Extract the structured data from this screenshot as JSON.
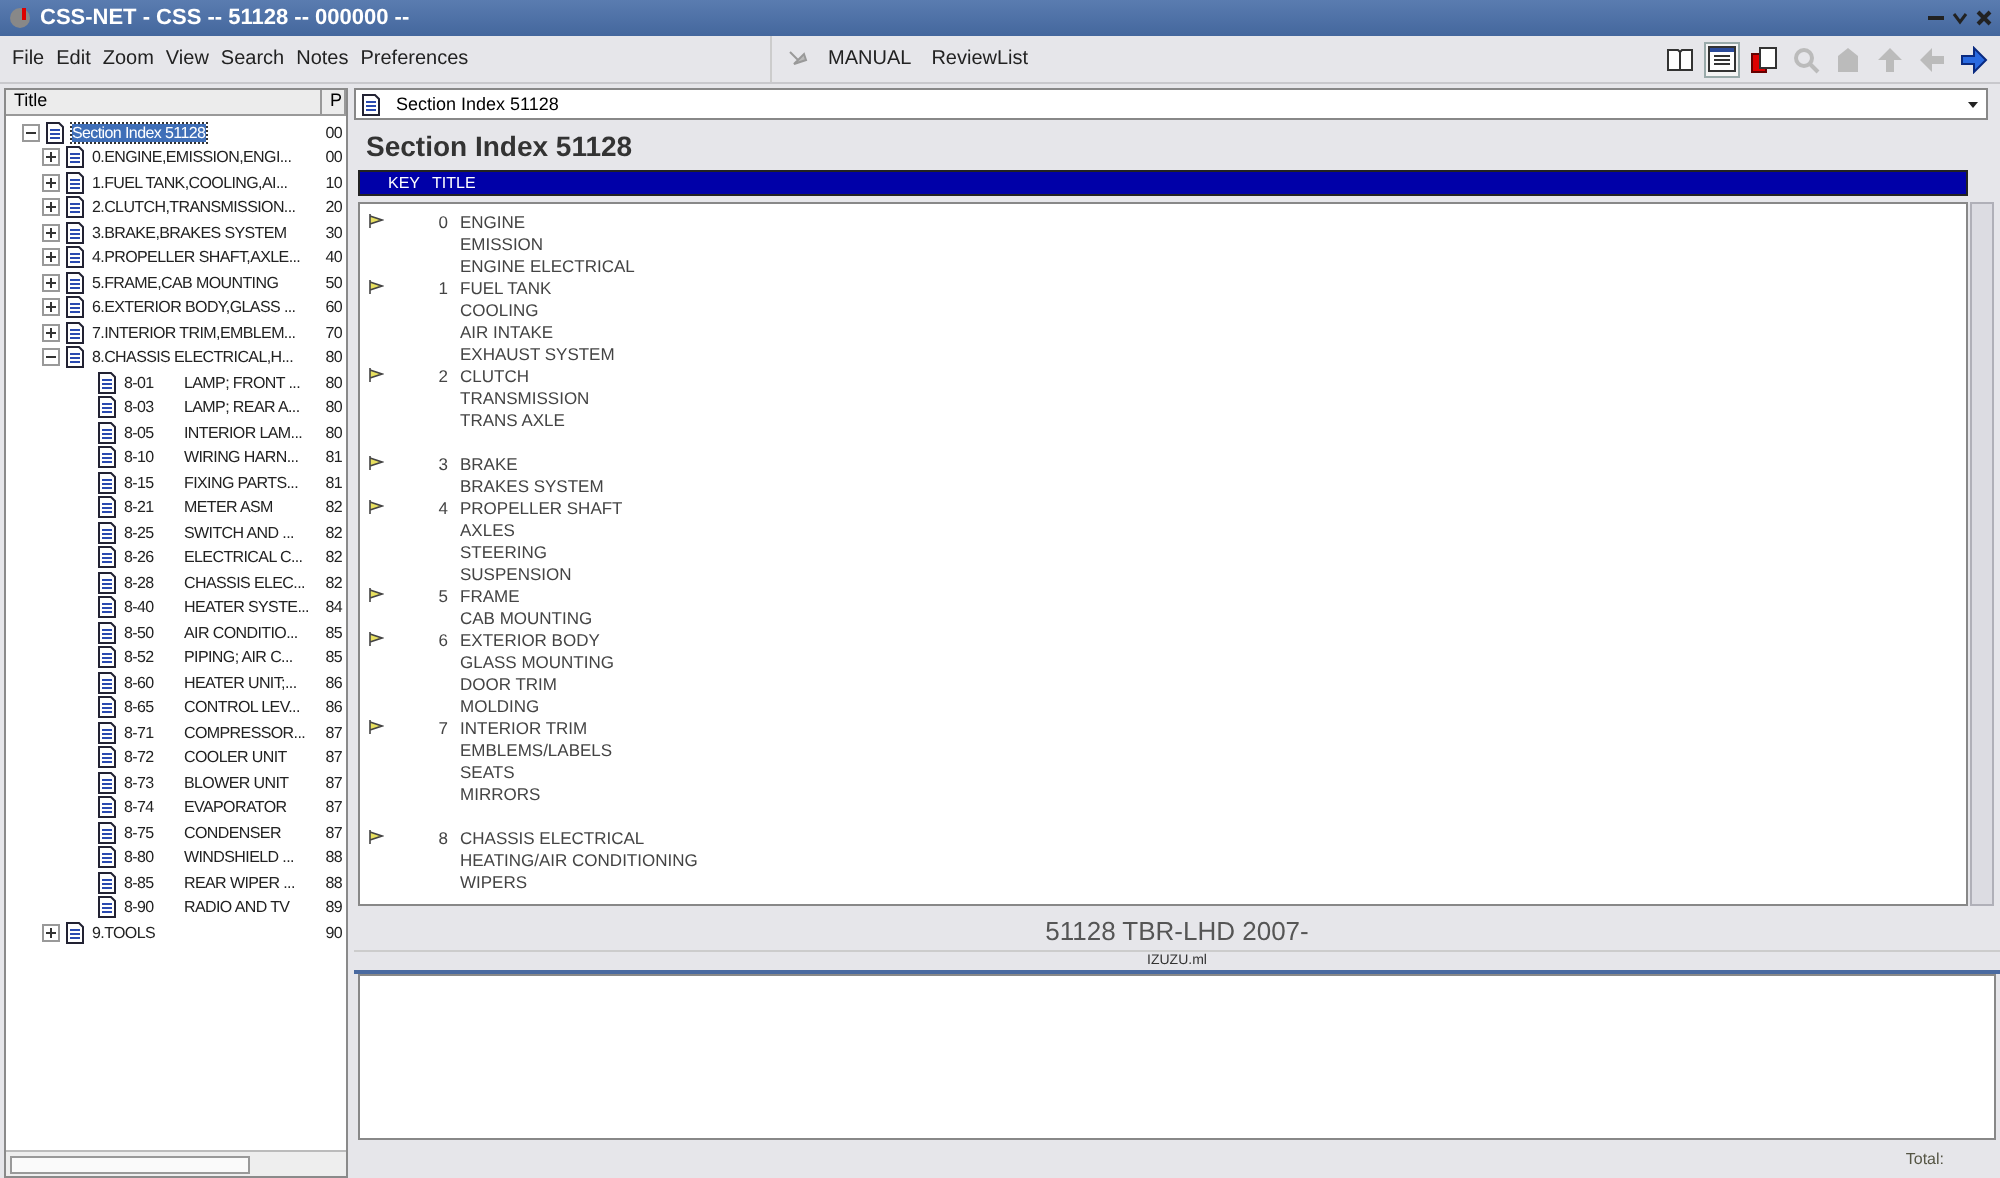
{
  "window": {
    "title": "CSS-NET - CSS -- 51128 -- 000000 --"
  },
  "menu": [
    "File",
    "Edit",
    "Zoom",
    "View",
    "Search",
    "Notes",
    "Preferences"
  ],
  "mode_buttons": [
    "MANUAL",
    "ReviewList"
  ],
  "toolbar": [
    {
      "kind": "book",
      "disabled": false,
      "pressed": false
    },
    {
      "kind": "list",
      "disabled": false,
      "pressed": true
    },
    {
      "kind": "pages",
      "disabled": false,
      "pressed": false
    },
    {
      "kind": "zoom",
      "disabled": true,
      "pressed": false
    },
    {
      "kind": "home",
      "disabled": true,
      "pressed": false
    },
    {
      "kind": "up",
      "disabled": true,
      "pressed": false
    },
    {
      "kind": "back",
      "disabled": true,
      "pressed": false
    },
    {
      "kind": "forward",
      "disabled": false,
      "pressed": false
    }
  ],
  "tree": {
    "columns": [
      "Title",
      "P"
    ],
    "root": {
      "title": "Section Index 51128",
      "page": "00",
      "selected": true,
      "expanded": true,
      "children": [
        {
          "title": "0.ENGINE,EMISSION,ENGI...",
          "page": "00",
          "expanded": false
        },
        {
          "title": "1.FUEL TANK,COOLING,AI...",
          "page": "10",
          "expanded": false
        },
        {
          "title": "2.CLUTCH,TRANSMISSION...",
          "page": "20",
          "expanded": false
        },
        {
          "title": "3.BRAKE,BRAKES SYSTEM",
          "page": "30",
          "expanded": false
        },
        {
          "title": "4.PROPELLER SHAFT,AXLE...",
          "page": "40",
          "expanded": false
        },
        {
          "title": "5.FRAME,CAB MOUNTING",
          "page": "50",
          "expanded": false
        },
        {
          "title": "6.EXTERIOR BODY,GLASS ...",
          "page": "60",
          "expanded": false
        },
        {
          "title": "7.INTERIOR TRIM,EMBLEM...",
          "page": "70",
          "expanded": false
        },
        {
          "title": "8.CHASSIS ELECTRICAL,H...",
          "page": "80",
          "expanded": true,
          "children": [
            {
              "code": "8-01",
              "title": "LAMP; FRONT ...",
              "page": "80"
            },
            {
              "code": "8-03",
              "title": "LAMP; REAR A...",
              "page": "80"
            },
            {
              "code": "8-05",
              "title": "INTERIOR LAM...",
              "page": "80"
            },
            {
              "code": "8-10",
              "title": "WIRING HARN...",
              "page": "81"
            },
            {
              "code": "8-15",
              "title": "FIXING PARTS...",
              "page": "81"
            },
            {
              "code": "8-21",
              "title": "METER ASM",
              "page": "82"
            },
            {
              "code": "8-25",
              "title": "SWITCH AND ...",
              "page": "82"
            },
            {
              "code": "8-26",
              "title": "ELECTRICAL C...",
              "page": "82"
            },
            {
              "code": "8-28",
              "title": "CHASSIS ELEC...",
              "page": "82"
            },
            {
              "code": "8-40",
              "title": "HEATER SYSTE...",
              "page": "84"
            },
            {
              "code": "8-50",
              "title": "AIR CONDITIO...",
              "page": "85"
            },
            {
              "code": "8-52",
              "title": "PIPING; AIR C...",
              "page": "85"
            },
            {
              "code": "8-60",
              "title": "HEATER UNIT;...",
              "page": "86"
            },
            {
              "code": "8-65",
              "title": "CONTROL LEV...",
              "page": "86"
            },
            {
              "code": "8-71",
              "title": "COMPRESSOR...",
              "page": "87"
            },
            {
              "code": "8-72",
              "title": "COOLER UNIT",
              "page": "87"
            },
            {
              "code": "8-73",
              "title": "BLOWER UNIT",
              "page": "87"
            },
            {
              "code": "8-74",
              "title": "EVAPORATOR",
              "page": "87"
            },
            {
              "code": "8-75",
              "title": "CONDENSER",
              "page": "87"
            },
            {
              "code": "8-80",
              "title": "WINDSHIELD ...",
              "page": "88"
            },
            {
              "code": "8-85",
              "title": "REAR WIPER ...",
              "page": "88"
            },
            {
              "code": "8-90",
              "title": "RADIO AND TV",
              "page": "89"
            }
          ]
        },
        {
          "title": "9.TOOLS",
          "page": "90",
          "expanded": false
        }
      ]
    }
  },
  "document": {
    "address": "Section Index 51128",
    "heading": "Section Index 51128",
    "columns": [
      "KEY",
      "TITLE"
    ],
    "groups": [
      {
        "kind": "group",
        "key": "0",
        "items": [
          "ENGINE",
          "EMISSION",
          "ENGINE ELECTRICAL"
        ]
      },
      {
        "kind": "group",
        "key": "1",
        "items": [
          "FUEL TANK",
          "COOLING",
          "AIR INTAKE",
          "EXHAUST SYSTEM"
        ]
      },
      {
        "kind": "group",
        "key": "2",
        "items": [
          "CLUTCH",
          "TRANSMISSION",
          "TRANS AXLE"
        ]
      },
      {
        "kind": "gap"
      },
      {
        "kind": "group",
        "key": "3",
        "items": [
          "BRAKE",
          "BRAKES SYSTEM"
        ]
      },
      {
        "kind": "group",
        "key": "4",
        "items": [
          "PROPELLER SHAFT",
          "AXLES",
          "STEERING",
          "SUSPENSION"
        ]
      },
      {
        "kind": "group",
        "key": "5",
        "items": [
          "FRAME",
          "CAB MOUNTING"
        ]
      },
      {
        "kind": "group",
        "key": "6",
        "items": [
          "EXTERIOR BODY",
          "GLASS MOUNTING",
          "DOOR TRIM",
          "MOLDING"
        ]
      },
      {
        "kind": "group",
        "key": "7",
        "items": [
          "INTERIOR TRIM",
          "EMBLEMS/LABELS",
          "SEATS",
          "MIRRORS"
        ]
      },
      {
        "kind": "gap"
      },
      {
        "kind": "group",
        "key": "8",
        "items": [
          "CHASSIS ELECTRICAL",
          "HEATING/AIR CONDITIONING",
          "WIPERS"
        ]
      }
    ],
    "footer": "51128 TBR-LHD 2007-"
  },
  "notes": {
    "title": "IZUZU.ml"
  },
  "status_bar": {
    "total": "Total:"
  }
}
